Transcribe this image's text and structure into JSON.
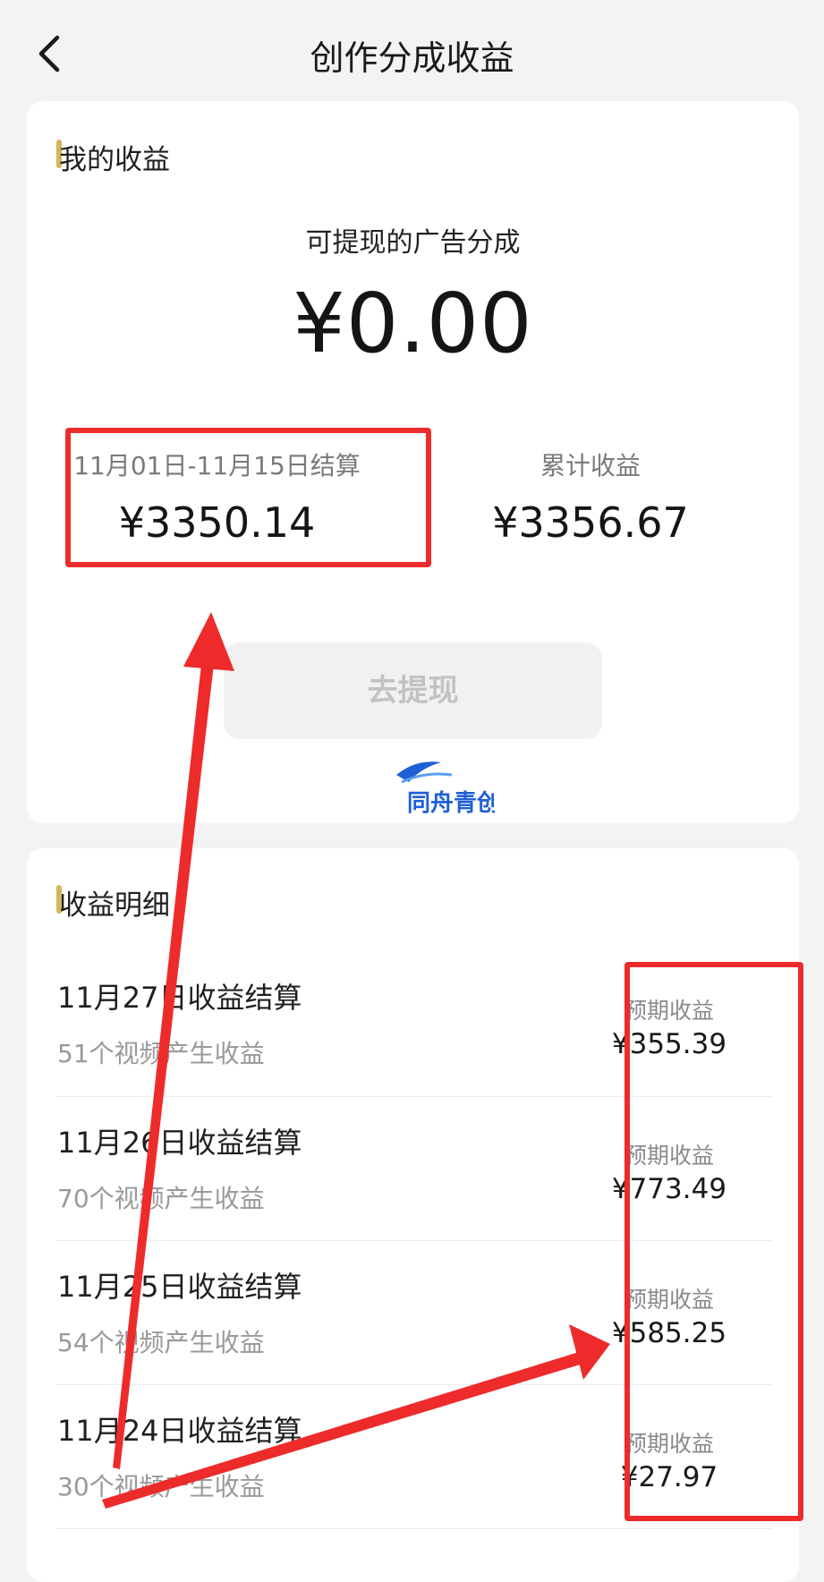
{
  "header": {
    "title": "创作分成收益"
  },
  "earnings": {
    "section_title": "我的收益",
    "withdrawable_label": "可提现的广告分成",
    "withdrawable_amount": "¥0.00",
    "settlement_label": "11月01日-11月15日结算",
    "settlement_amount": "¥3350.14",
    "total_label": "累计收益",
    "total_amount": "¥3356.67",
    "withdraw_button": "去提现"
  },
  "detail": {
    "section_title": "收益明细",
    "rows": [
      {
        "title": "11月27日收益结算",
        "subtitle": "51个视频产生收益",
        "expected_label": "预期收益",
        "expected_amount": "¥355.39"
      },
      {
        "title": "11月26日收益结算",
        "subtitle": "70个视频产生收益",
        "expected_label": "预期收益",
        "expected_amount": "¥773.49"
      },
      {
        "title": "11月25日收益结算",
        "subtitle": "54个视频产生收益",
        "expected_label": "预期收益",
        "expected_amount": "¥585.25"
      },
      {
        "title": "11月24日收益结算",
        "subtitle": "30个视频产生收益",
        "expected_label": "预期收益",
        "expected_amount": "¥27.97"
      }
    ]
  },
  "watermark": {
    "text": "同舟青创"
  },
  "colors": {
    "accent_bar": "#d8b45a",
    "annotation_red": "#ee2b2b",
    "watermark_blue": "#1f5fd6"
  },
  "icons": {
    "back": "chevron-left-icon"
  }
}
